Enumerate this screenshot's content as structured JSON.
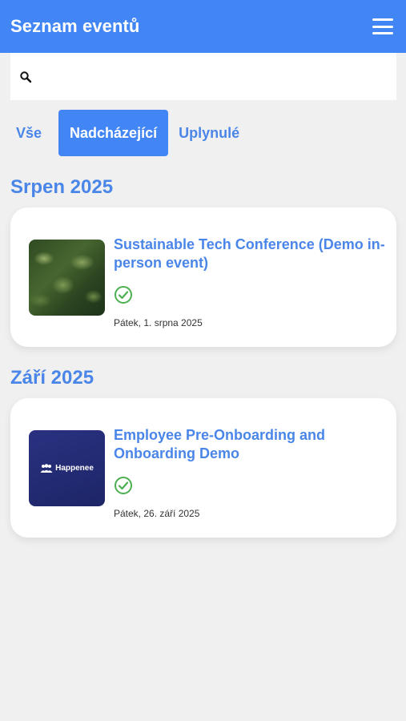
{
  "header": {
    "title": "Seznam eventů"
  },
  "search": {
    "placeholder": "",
    "value": ""
  },
  "tabs": [
    {
      "label": "Vše",
      "active": false
    },
    {
      "label": "Nadcházející",
      "active": true
    },
    {
      "label": "Uplynulé",
      "active": false
    }
  ],
  "sections": [
    {
      "title": "Srpen 2025",
      "events": [
        {
          "title": "Sustainable Tech Conference (Demo in-person event)",
          "date": "Pátek, 1. srpna 2025",
          "thumbnail": "forest-photo"
        }
      ]
    },
    {
      "title": "Září 2025",
      "events": [
        {
          "title": "Employee Pre-Onboarding and Onboarding Demo",
          "date": "Pátek, 26. září 2025",
          "thumbnail": "happenee-logo",
          "thumbnail_text": "Happenee"
        }
      ]
    }
  ],
  "colors": {
    "primary": "#4285f4",
    "accent_text": "#4a86e8",
    "success": "#4caf50",
    "background": "#f0f0f0"
  }
}
